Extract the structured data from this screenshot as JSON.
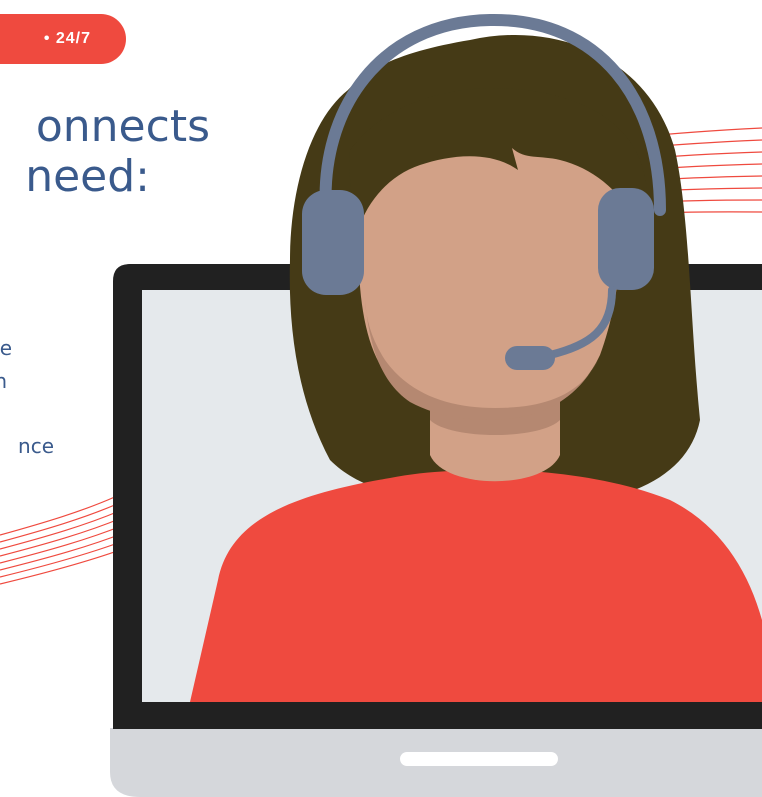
{
  "badge": {
    "text": "• 24/7"
  },
  "headline": {
    "line1": "onnects",
    "line2": "need:"
  },
  "bullets": [
    {
      "text": "e"
    },
    {
      "text": "n"
    },
    {
      "text": "nce"
    }
  ],
  "colors": {
    "accent_red": "#ef4a3f",
    "text_blue": "#3a5a8c",
    "hair": "#453a16",
    "skin": "#d2a187",
    "headset": "#6b7a95",
    "laptop_frame": "#212121",
    "screen": "#e5e9ec",
    "base": "#d5d7db"
  },
  "icons": [
    "agent-illustration",
    "laptop-icon",
    "headset-icon"
  ]
}
